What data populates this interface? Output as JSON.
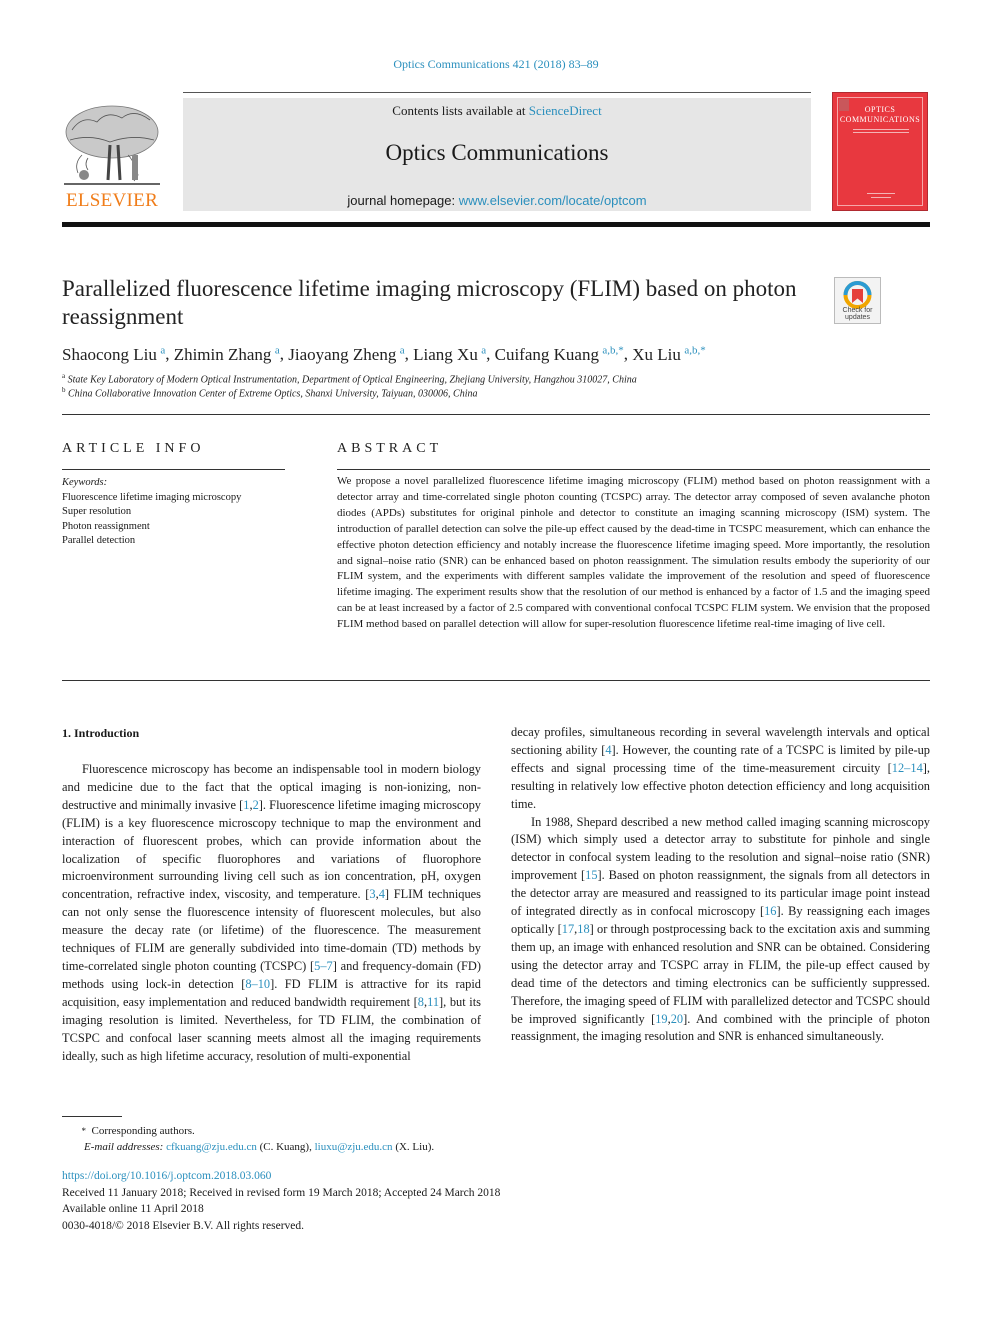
{
  "header": {
    "journal_ref": "Optics Communications 421 (2018) 83–89",
    "contents_prefix": "Contents lists available at ",
    "contents_link": "ScienceDirect",
    "journal_name": "Optics Communications",
    "homepage_prefix": "journal homepage: ",
    "homepage_link": "www.elsevier.com/locate/optcom",
    "publisher_logo_text": "ELSEVIER",
    "cover_title_line1": "OPTICS",
    "cover_title_line2": "COMMUNICATIONS"
  },
  "article": {
    "title": "Parallelized fluorescence lifetime imaging microscopy (FLIM) based on photon reassignment",
    "crossmark_label_1": "Check for",
    "crossmark_label_2": "updates",
    "authors": [
      {
        "name": "Shaocong Liu",
        "sup": "a"
      },
      {
        "name": "Zhimin Zhang",
        "sup": "a"
      },
      {
        "name": "Jiaoyang Zheng",
        "sup": "a"
      },
      {
        "name": "Liang Xu",
        "sup": "a"
      },
      {
        "name": "Cuifang Kuang",
        "sup": "a,b,*"
      },
      {
        "name": "Xu Liu",
        "sup": "a,b,*"
      }
    ],
    "affiliations": [
      {
        "key": "a",
        "text": "State Key Laboratory of Modern Optical Instrumentation, Department of Optical Engineering, Zhejiang University, Hangzhou 310027, China"
      },
      {
        "key": "b",
        "text": "China Collaborative Innovation Center of Extreme Optics, Shanxi University, Taiyuan, 030006, China"
      }
    ]
  },
  "article_info": {
    "heading": "ARTICLE INFO",
    "keywords_label": "Keywords:",
    "keywords": [
      "Fluorescence lifetime imaging microscopy",
      "Super resolution",
      "Photon reassignment",
      "Parallel detection"
    ]
  },
  "abstract": {
    "heading": "ABSTRACT",
    "text": "We propose a novel parallelized fluorescence lifetime imaging microscopy (FLIM) method based on photon reassignment with a detector array and time-correlated single photon counting (TCSPC) array. The detector array composed of seven avalanche photon diodes (APDs) substitutes for original pinhole and detector to constitute an imaging scanning microscopy (ISM) system. The introduction of parallel detection can solve the pile-up effect caused by the dead-time in TCSPC measurement, which can enhance the effective photon detection efficiency and notably increase the fluorescence lifetime imaging speed. More importantly, the resolution and signal–noise ratio (SNR) can be enhanced based on photon reassignment. The simulation results embody the superiority of our FLIM system, and the experiments with different samples validate the improvement of the resolution and speed of fluorescence lifetime imaging. The experiment results show that the resolution of our method is enhanced by a factor of 1.5 and the imaging speed can be at least increased by a factor of 2.5 compared with conventional confocal TCSPC FLIM system. We envision that the proposed FLIM method based on parallel detection will allow for super-resolution fluorescence lifetime real-time imaging of live cell."
  },
  "introduction": {
    "heading": "1.  Introduction",
    "paragraphs": [
      [
        {
          "t": "Fluorescence microscopy has become an indispensable tool in mod­ern biology and medicine due to the fact that the optical imaging is non-ionizing, non-destructive and minimally invasive ["
        },
        {
          "ref": "1"
        },
        {
          "t": ","
        },
        {
          "ref": "2"
        },
        {
          "t": "]. Fluorescence lifetime imaging microscopy (FLIM) is a key fluorescence microscopy technique to map the environment and interaction of fluorescent probes, which can provide information about the localization of specific fluo­rophores and variations of fluorophore microenvironment surrounding living cell such as ion concentration, pH, oxygen concentration, refrac­tive index, viscosity, and temperature. ["
        },
        {
          "ref": "3"
        },
        {
          "t": ","
        },
        {
          "ref": "4"
        },
        {
          "t": "] FLIM techniques can not only sense the fluorescence intensity of fluorescent molecules, but also measure the decay rate (or lifetime) of the fluorescence. The measure­ment techniques of FLIM are generally subdivided into time-domain (TD) methods by time-correlated single photon counting (TCSPC) ["
        },
        {
          "ref": "5–7"
        },
        {
          "t": "] and frequency-domain (FD) methods using lock-in detection ["
        },
        {
          "ref": "8–10"
        },
        {
          "t": "]. FD FLIM is attractive for its rapid acquisition, easy implementation and reduced bandwidth requirement ["
        },
        {
          "ref": "8"
        },
        {
          "t": ","
        },
        {
          "ref": "11"
        },
        {
          "t": "], but its imaging resolution is limited. Nevertheless, for TD FLIM, the combination of TCSPC and confocal laser scanning meets almost all the imaging requirements ideally, such as high lifetime accuracy, resolution of multi-exponential decay profiles, simultaneous recording in several wavelength intervals and optical sectioning ability ["
        },
        {
          "ref": "4"
        },
        {
          "t": "]. However, the counting rate of a TCSPC is limited by pile-up effects and signal processing time of the time-measurement circuity ["
        },
        {
          "ref": "12–14"
        },
        {
          "t": "], resulting in relatively low effective photon detection efficiency and long acquisition time."
        }
      ],
      [
        {
          "t": "In 1988, Shepard described a new method called imaging scanning microscopy (ISM) which simply used a detector array to substitute for pinhole and single detector in confocal system leading to the resolution and signal–noise ratio (SNR) improvement ["
        },
        {
          "ref": "15"
        },
        {
          "t": "]. Based on photon reassignment, the signals from all detectors in the detector array are measured and reassigned to its particular image point instead of integrated directly as in confocal microscopy ["
        },
        {
          "ref": "16"
        },
        {
          "t": "]. By reassigning each images optically ["
        },
        {
          "ref": "17"
        },
        {
          "t": ","
        },
        {
          "ref": "18"
        },
        {
          "t": "] or through postprocessing back to the excita­tion axis and summing them up, an image with enhanced resolution and SNR can be obtained. Considering using the detector array and TCSPC array in FLIM, the pile-up effect caused by dead time of the detectors and timing electronics can be sufficiently suppressed. Therefore, the imaging speed of FLIM with parallelized detector and TCSPC should be improved significantly ["
        },
        {
          "ref": "19"
        },
        {
          "t": ","
        },
        {
          "ref": "20"
        },
        {
          "t": "]. And combined with the principle of photon reassignment, the imaging resolution and SNR is enhanced simultaneously."
        }
      ]
    ]
  },
  "footnotes": {
    "star": "*",
    "corresponding": "Corresponding authors.",
    "email_label": "E-mail addresses:",
    "emails": [
      {
        "address": "cfkuang@zju.edu.cn",
        "who": "(C. Kuang)"
      },
      {
        "address": "liuxu@zju.edu.cn",
        "who": "(X. Liu)."
      }
    ]
  },
  "pub_info": {
    "doi": "https://doi.org/10.1016/j.optcom.2018.03.060",
    "history": "Received 11 January 2018; Received in revised form 19 March 2018; Accepted 24 March 2018",
    "available": "Available online 11 April 2018",
    "copyright": "0030-4018/© 2018 Elsevier B.V. All rights reserved."
  },
  "colors": {
    "link": "#2a8fbd",
    "elsevier_orange": "#f07d1a",
    "cover_red": "#e8383f",
    "masthead_gray": "#e6e6e6"
  }
}
